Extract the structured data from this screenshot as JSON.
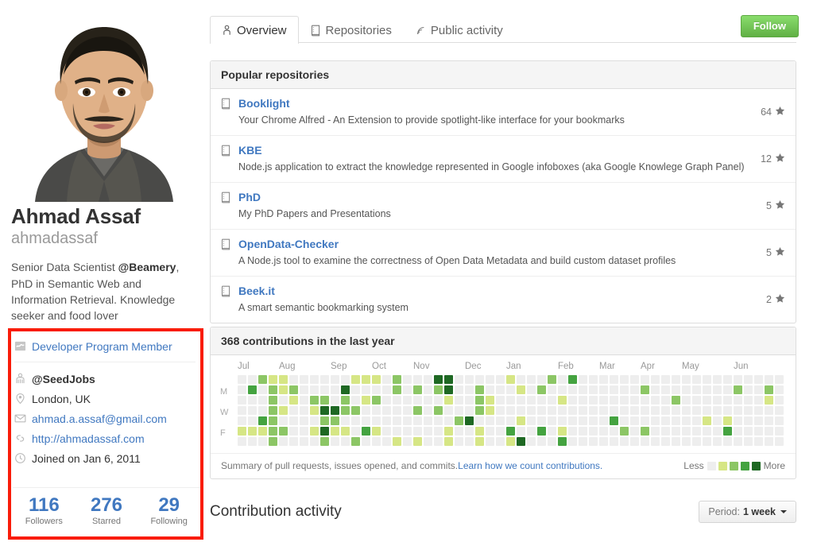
{
  "profile": {
    "avatar_alt": "user-avatar-photo",
    "fullname": "Ahmad Assaf",
    "username": "ahmadassaf",
    "bio_before": "Senior Data Scientist ",
    "bio_org": "@Beamery",
    "bio_after": ", PhD in Semantic Web and Information Retrieval. Knowledge seeker and food lover"
  },
  "badges": {
    "developer_program": "Developer Program Member"
  },
  "details": [
    {
      "icon": "organization-icon",
      "text": "@SeedJobs",
      "style": "bold"
    },
    {
      "icon": "location-icon",
      "text": "London, UK",
      "style": "plain"
    },
    {
      "icon": "mail-icon",
      "text": "ahmad.a.assaf@gmail.com",
      "style": "link"
    },
    {
      "icon": "link-icon",
      "text": "http://ahmadassaf.com",
      "style": "link"
    },
    {
      "icon": "clock-icon",
      "text": "Joined on Jan 6, 2011",
      "style": "plain"
    }
  ],
  "stats": [
    {
      "num": "116",
      "label": "Followers"
    },
    {
      "num": "276",
      "label": "Starred"
    },
    {
      "num": "29",
      "label": "Following"
    }
  ],
  "tabs": [
    {
      "label": "Overview",
      "icon": "person-icon",
      "active": true
    },
    {
      "label": "Repositories",
      "icon": "repo-icon",
      "active": false
    },
    {
      "label": "Public activity",
      "icon": "rss-icon",
      "active": false
    }
  ],
  "follow_button": "Follow",
  "repos_panel": {
    "title": "Popular repositories",
    "items": [
      {
        "name": "Booklight",
        "desc": "Your Chrome Alfred - An Extension to provide spotlight-like interface for your bookmarks",
        "stars": "64"
      },
      {
        "name": "KBE",
        "desc": "Node.js application to extract the knowledge represented in Google infoboxes (aka Google Knowlege Graph Panel)",
        "stars": "12"
      },
      {
        "name": "PhD",
        "desc": "My PhD Papers and Presentations",
        "stars": "5"
      },
      {
        "name": "OpenData-Checker",
        "desc": "A Node.js tool to examine the correctness of Open Data Metadata and build custom dataset profiles",
        "stars": "5"
      },
      {
        "name": "Beek.it",
        "desc": "A smart semantic bookmarking system",
        "stars": "2"
      }
    ]
  },
  "contributions": {
    "title": "368 contributions in the last year",
    "footer_text": "Summary of pull requests, issues opened, and commits. ",
    "footer_link": "Learn how we count contributions.",
    "legend_less": "Less",
    "legend_more": "More"
  },
  "activity": {
    "title": "Contribution activity",
    "period_label": "Period:",
    "period_value": "1 week"
  },
  "chart_data": {
    "type": "heatmap",
    "title": "368 contributions in the last year",
    "total_contributions": 368,
    "xlabel": "",
    "ylabel": "",
    "grid": false,
    "legend_position": "bottom-right",
    "day_labels": [
      "",
      "M",
      "",
      "W",
      "",
      "F",
      ""
    ],
    "month_labels": [
      "Jul",
      "Aug",
      "Sep",
      "Oct",
      "Nov",
      "Dec",
      "Jan",
      "Feb",
      "Mar",
      "Apr",
      "May",
      "Jun"
    ],
    "month_col_index": [
      0,
      4,
      9,
      13,
      17,
      22,
      26,
      31,
      35,
      39,
      43,
      48
    ],
    "levels": [
      0,
      1,
      2,
      3,
      4
    ],
    "level_colors": [
      "#eeeeee",
      "#d6e685",
      "#8cc665",
      "#44a340",
      "#1e6823"
    ],
    "weeks": [
      [
        0,
        0,
        0,
        0,
        0,
        1,
        0
      ],
      [
        0,
        3,
        0,
        0,
        0,
        1,
        0
      ],
      [
        2,
        0,
        0,
        0,
        3,
        1,
        0
      ],
      [
        1,
        2,
        2,
        2,
        2,
        2,
        2
      ],
      [
        1,
        1,
        0,
        1,
        0,
        2,
        0
      ],
      [
        0,
        2,
        1,
        0,
        0,
        0,
        0
      ],
      [
        0,
        0,
        0,
        0,
        0,
        0,
        0
      ],
      [
        0,
        0,
        2,
        1,
        0,
        1,
        0
      ],
      [
        0,
        0,
        2,
        4,
        2,
        4,
        2
      ],
      [
        0,
        0,
        0,
        4,
        2,
        1,
        0
      ],
      [
        0,
        4,
        2,
        2,
        0,
        1,
        0
      ],
      [
        1,
        0,
        0,
        2,
        0,
        0,
        2
      ],
      [
        1,
        0,
        1,
        0,
        0,
        3,
        0
      ],
      [
        1,
        0,
        2,
        0,
        0,
        1,
        0
      ],
      [
        0,
        0,
        0,
        0,
        0,
        0,
        0
      ],
      [
        2,
        2,
        0,
        0,
        0,
        0,
        1
      ],
      [
        0,
        0,
        0,
        0,
        0,
        0,
        0
      ],
      [
        0,
        2,
        0,
        2,
        0,
        0,
        1
      ],
      [
        0,
        0,
        0,
        0,
        0,
        0,
        0
      ],
      [
        4,
        2,
        0,
        2,
        0,
        0,
        0
      ],
      [
        4,
        4,
        1,
        0,
        0,
        1,
        1
      ],
      [
        0,
        0,
        0,
        0,
        2,
        0,
        0
      ],
      [
        0,
        0,
        0,
        0,
        4,
        0,
        0
      ],
      [
        0,
        2,
        2,
        2,
        0,
        1,
        1
      ],
      [
        0,
        0,
        1,
        1,
        0,
        0,
        0
      ],
      [
        0,
        0,
        0,
        0,
        0,
        0,
        0
      ],
      [
        1,
        0,
        0,
        0,
        0,
        3,
        1
      ],
      [
        0,
        1,
        0,
        0,
        1,
        0,
        4
      ],
      [
        0,
        0,
        0,
        0,
        0,
        0,
        0
      ],
      [
        0,
        2,
        0,
        0,
        0,
        3,
        0
      ],
      [
        2,
        0,
        0,
        0,
        0,
        0,
        0
      ],
      [
        0,
        0,
        1,
        0,
        0,
        1,
        3
      ],
      [
        3,
        0,
        0,
        0,
        0,
        0,
        0
      ],
      [
        0,
        0,
        0,
        0,
        0,
        0,
        0
      ],
      [
        0,
        0,
        0,
        0,
        0,
        0,
        0
      ],
      [
        0,
        0,
        0,
        0,
        0,
        0,
        0
      ],
      [
        0,
        0,
        0,
        0,
        3,
        0,
        0
      ],
      [
        0,
        0,
        0,
        0,
        0,
        2,
        0
      ],
      [
        0,
        0,
        0,
        0,
        0,
        0,
        0
      ],
      [
        0,
        2,
        0,
        0,
        0,
        2,
        0
      ],
      [
        0,
        0,
        0,
        0,
        0,
        0,
        0
      ],
      [
        0,
        0,
        0,
        0,
        0,
        0,
        0
      ],
      [
        0,
        0,
        2,
        0,
        0,
        0,
        0
      ],
      [
        0,
        0,
        0,
        0,
        0,
        0,
        0
      ],
      [
        0,
        0,
        0,
        0,
        0,
        0,
        0
      ],
      [
        0,
        0,
        0,
        0,
        1,
        0,
        0
      ],
      [
        0,
        0,
        0,
        0,
        0,
        0,
        0
      ],
      [
        0,
        0,
        0,
        0,
        1,
        3,
        0
      ],
      [
        0,
        2,
        0,
        0,
        0,
        0,
        0
      ],
      [
        0,
        0,
        0,
        0,
        0,
        0,
        0
      ],
      [
        0,
        0,
        0,
        0,
        0,
        0,
        0
      ],
      [
        0,
        2,
        1,
        0,
        0,
        0,
        0
      ],
      [
        0,
        0,
        0,
        0,
        0,
        0,
        0
      ]
    ]
  }
}
